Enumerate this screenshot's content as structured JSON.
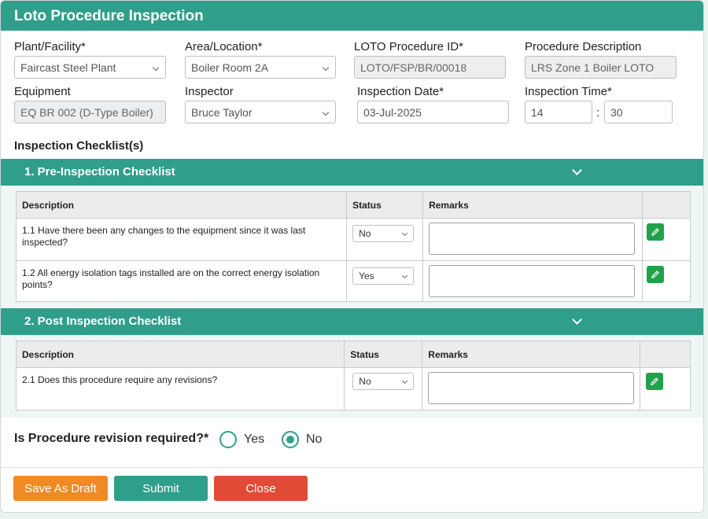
{
  "window": {
    "title": "Loto Procedure Inspection"
  },
  "form": {
    "plant": {
      "label": "Plant/Facility*",
      "value": "Faircast Steel Plant"
    },
    "area": {
      "label": "Area/Location*",
      "value": "Boiler Room 2A"
    },
    "procedure_id": {
      "label": "LOTO Procedure ID*",
      "value": "LOTO/FSP/BR/00018"
    },
    "procedure_desc": {
      "label": "Procedure Description",
      "value": "LRS Zone 1 Boiler LOTO"
    },
    "equipment": {
      "label": "Equipment",
      "value": "EQ BR 002 (D-Type Boiler)"
    },
    "inspector": {
      "label": "Inspector",
      "value": "Bruce Taylor"
    },
    "date": {
      "label": "Inspection Date*",
      "value": "03-Jul-2025"
    },
    "time": {
      "label": "Inspection Time*",
      "hour": "14",
      "separator": ":",
      "minute": "30"
    }
  },
  "checklists_title": "Inspection Checklist(s)",
  "columns": {
    "description": "Description",
    "status": "Status",
    "remarks": "Remarks"
  },
  "pre": {
    "title": "1. Pre-Inspection Checklist",
    "rows": [
      {
        "description": "1.1 Have there been any changes to the equipment since it was last inspected?",
        "status": "No"
      },
      {
        "description": "1.2 All energy isolation tags installed are on the correct energy isolation points?",
        "status": "Yes"
      }
    ]
  },
  "post": {
    "title": "2. Post Inspection Checklist",
    "rows": [
      {
        "description": "2.1 Does this procedure require any revisions?",
        "status": "No"
      }
    ]
  },
  "revision": {
    "question": "Is Procedure revision required?*",
    "yes": "Yes",
    "no": "No",
    "selected": "No"
  },
  "buttons": {
    "draft": "Save As Draft",
    "submit": "Submit",
    "close": "Close"
  },
  "colors": {
    "accent": "#2f9e8a",
    "draft": "#f08a24",
    "close": "#e04b36",
    "edit": "#1fa34a"
  }
}
